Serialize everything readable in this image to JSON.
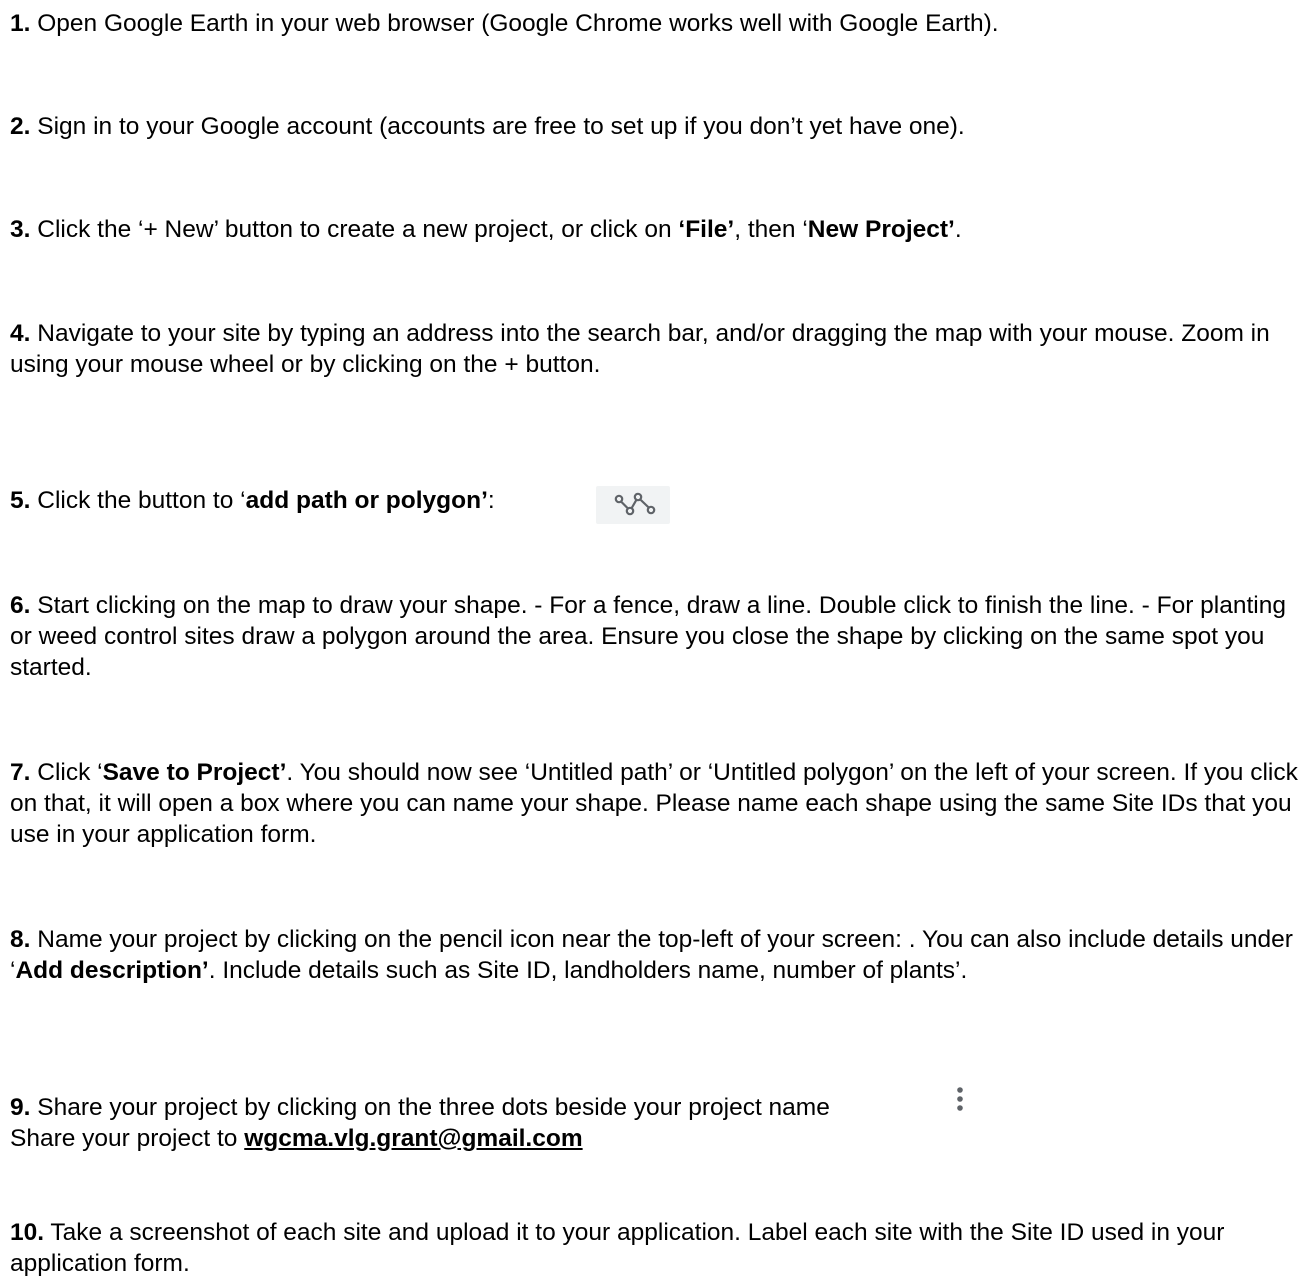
{
  "steps": [
    {
      "number": "1.",
      "parts": [
        " Open Google Earth in your web browser (Google Chrome works well with Google Earth)."
      ]
    },
    {
      "number": "2.",
      "parts": [
        " Sign in to your Google account (accounts are free to set up if you don’t yet have one)."
      ]
    },
    {
      "number": "3.",
      "parts": [
        " Click the ‘+ New’ button to create a new project, or click on ",
        "‘File’",
        ", then ‘",
        "New Project’",
        "."
      ]
    },
    {
      "number": "4.",
      "parts": [
        " Navigate to your site by typing an address into the search bar, and/or dragging the map with your mouse. Zoom in using your mouse wheel or by clicking on the + button."
      ]
    },
    {
      "number": "5.",
      "parts": [
        " Click the button to ‘",
        "add path or polygon’",
        ":"
      ]
    },
    {
      "number": "6.",
      "parts": [
        " Start clicking on the map to draw your shape. - For a fence, draw a line. Double click to finish the line. - For planting or weed control sites draw a polygon around the area. Ensure you close the shape by clicking on the same spot you started."
      ]
    },
    {
      "number": "7.",
      "parts": [
        " Click ‘",
        "Save to Project’",
        ". You should now see ‘Untitled path’ or ‘Untitled polygon’ on the left of your screen. If you click on that, it will open a box where you can name your shape. Please name each shape using the same Site IDs that you use in your application form."
      ]
    },
    {
      "number": "8.",
      "parts": [
        " Name your project by clicking on the pencil icon near the top-left of your screen: . You can also include details under ‘",
        "Add description’",
        ". Include details such as Site ID, landholders name, number of plants’."
      ]
    },
    {
      "number": "9.",
      "parts": [
        " Share your project by clicking on the three dots beside your project name",
        "Share your project to ",
        "wgcma.vlg.grant@gmail.com"
      ]
    },
    {
      "number": "10.",
      "parts": [
        " Take a screenshot of each site and upload it to your application. Label each site with the Site ID used in your application form."
      ]
    }
  ],
  "icons": {
    "path_polygon": "add-path-or-polygon-icon",
    "three_dots": "more-vertical-icon",
    "icon_color": "#5f6368",
    "icon_background": "#f1f3f4"
  }
}
